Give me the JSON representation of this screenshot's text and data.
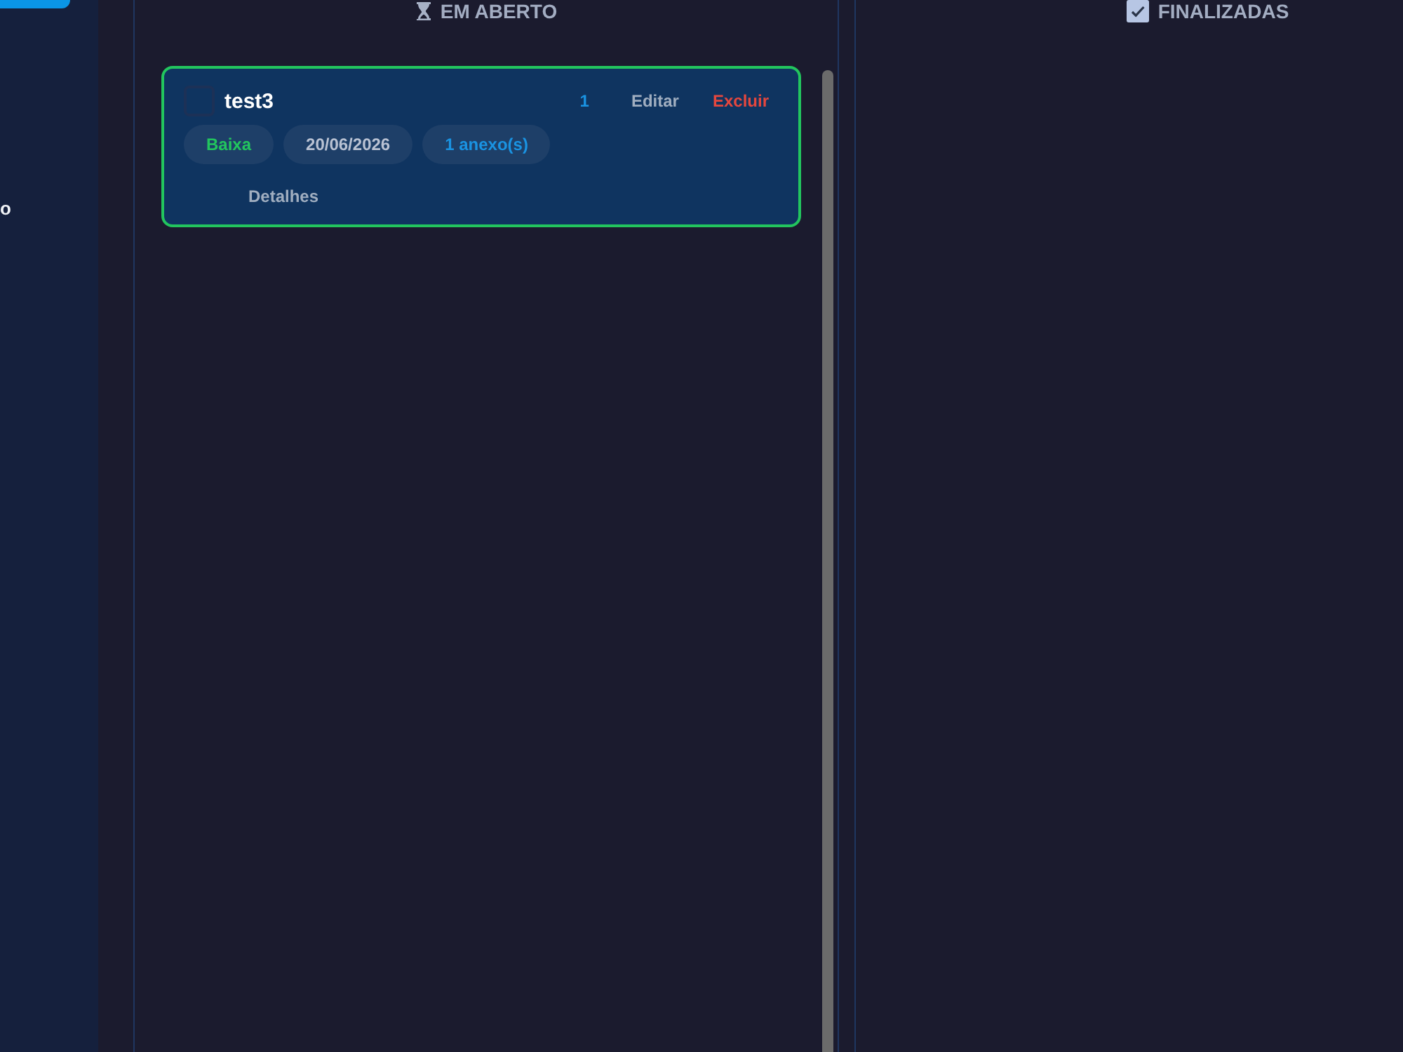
{
  "sidebar": {
    "button": {
      "selected": true
    },
    "label": "o"
  },
  "columns": [
    {
      "kind": "open",
      "title": "EM ABERTO",
      "cards": [
        {
          "title": "test3",
          "checked": false,
          "color": "#22c55e",
          "count": "1",
          "actions": [
            {
              "kind": "edit",
              "label": "Editar"
            },
            {
              "kind": "delete",
              "label": "Excluir"
            }
          ],
          "tags": [
            {
              "kind": "priority",
              "label": "Baixa"
            },
            {
              "kind": "date",
              "label": "20/06/2026"
            },
            {
              "kind": "attachments",
              "label": "1 anexo(s)"
            }
          ],
          "details": "Detalhes"
        }
      ]
    },
    {
      "kind": "done",
      "title": "FINALIZADAS"
    }
  ]
}
